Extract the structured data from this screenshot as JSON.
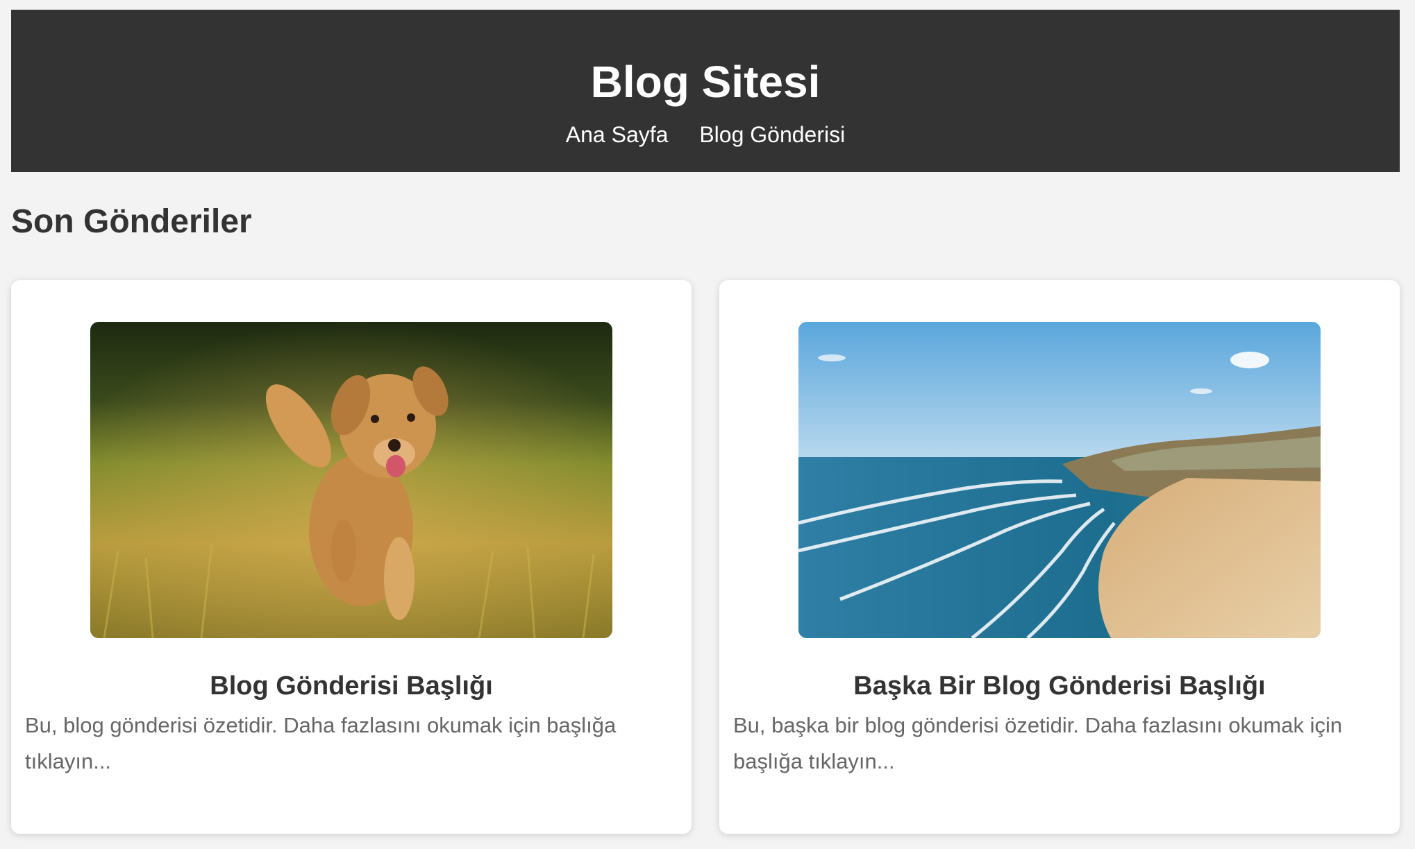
{
  "header": {
    "title": "Blog Sitesi",
    "nav": [
      {
        "label": "Ana Sayfa"
      },
      {
        "label": "Blog Gönderisi"
      }
    ]
  },
  "main": {
    "section_title": "Son Gönderiler",
    "posts": [
      {
        "title": "Blog Gönderisi Başlığı",
        "excerpt": "Bu, blog gönderisi özetidir. Daha fazlasını okumak için başlığa tıklayın...",
        "image": "golden-retriever-running-in-grass-photo"
      },
      {
        "title": "Başka Bir Blog Gönderisi Başlığı",
        "excerpt": "Bu, başka bir blog gönderisi özetidir. Daha fazlasını okumak için başlığa tıklayın...",
        "image": "aerial-beach-coastline-photo"
      }
    ]
  },
  "colors": {
    "header_bg": "#333333",
    "page_bg": "#f3f3f3",
    "card_bg": "#ffffff",
    "text": "#333333",
    "excerpt_text": "#666666"
  }
}
